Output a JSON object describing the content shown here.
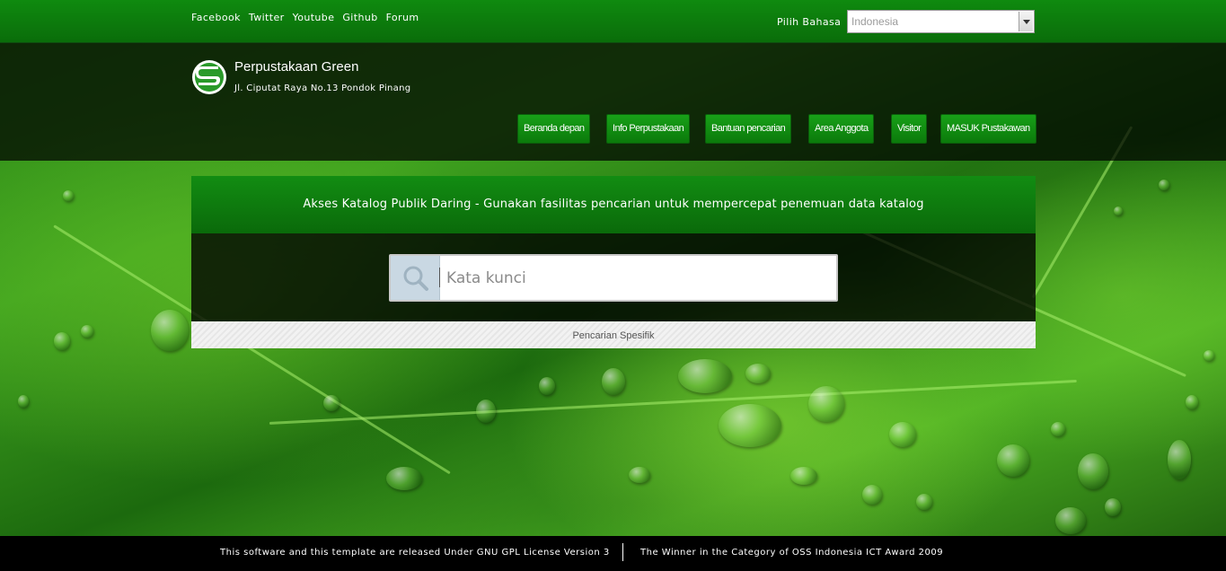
{
  "social_links": [
    "Facebook",
    "Twitter",
    "Youtube",
    "Github",
    "Forum"
  ],
  "language": {
    "label": "Pilih Bahasa",
    "selected": "Indonesia"
  },
  "site": {
    "title": "Perpustakaan Green",
    "address": "Jl. Ciputat Raya No.13 Pondok Pinang"
  },
  "nav": [
    "Beranda depan",
    "Info Perpustakaan",
    "Bantuan pencarian",
    "Area Anggota",
    "Visitor",
    "MASUK Pustakawan"
  ],
  "search": {
    "heading": "Akses Katalog Publik Daring - Gunakan fasilitas pencarian untuk mempercepat penemuan data katalog",
    "placeholder": "Kata kunci",
    "advanced_label": "Pencarian Spesifik"
  },
  "footer": {
    "license": "This software and this template are released Under GNU GPL License Version 3",
    "award": "The Winner in the Category of OSS Indonesia ICT Award 2009"
  },
  "colors": {
    "brand_green": "#0f8a0f",
    "nav_button": "#18a018"
  },
  "icons": {
    "logo": "senayan-s-logo",
    "search": "magnifier-icon",
    "dropdown": "chevron-down-icon"
  }
}
